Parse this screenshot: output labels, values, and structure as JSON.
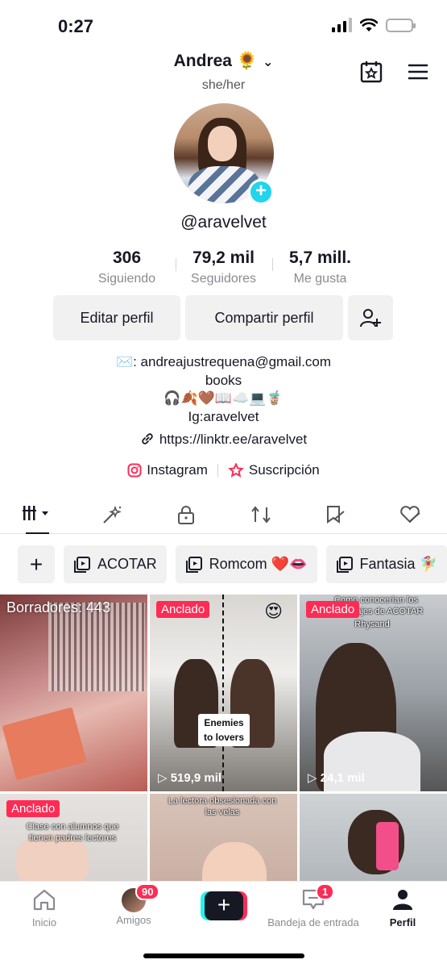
{
  "status": {
    "time": "0:27"
  },
  "profile": {
    "display_name": "Andrea 🌻",
    "pronouns": "she/her",
    "username": "@aravelvet",
    "stats": [
      {
        "value": "306",
        "label": "Siguiendo"
      },
      {
        "value": "79,2 mil",
        "label": "Seguidores"
      },
      {
        "value": "5,7 mill.",
        "label": "Me gusta"
      }
    ],
    "buttons": {
      "edit": "Editar perfil",
      "share": "Compartir perfil"
    },
    "bio": [
      "✉️: andreajustrequena@gmail.com",
      "books",
      "🎧🍂🤎📖☁️💻🧋",
      "Ig:aravelvet"
    ],
    "link": "https://linktr.ee/aravelvet",
    "social": {
      "instagram": "Instagram",
      "subscription": "Suscripción"
    }
  },
  "playlists": [
    "ACOTAR",
    "Romcom ❤️👄",
    "Fantasia 🧚‍♀️"
  ],
  "videos": [
    {
      "overlay": "Borradores: 443"
    },
    {
      "pinned": "Anclado",
      "views": "519,9 mil",
      "caption": "Enemies to lovers",
      "emoji": "😍"
    },
    {
      "pinned": "Anclado",
      "views": "24,1 mil",
      "caption": "Como conocerían los personajes de ACOTAR",
      "caption2": "Rhysand"
    },
    {
      "pinned": "Anclado",
      "caption": "Clase con alumnos que tienen padres lectores"
    },
    {
      "caption": "La lectora obsesionada con las velas"
    },
    {}
  ],
  "nav": {
    "home": "Inicio",
    "friends": "Amigos",
    "friends_badge": "90",
    "inbox": "Bandeja de entrada",
    "inbox_badge": "1",
    "profile": "Perfil"
  },
  "colors": {
    "accent": "#fe2c55",
    "cyan": "#20d5ec",
    "text": "#161823"
  }
}
